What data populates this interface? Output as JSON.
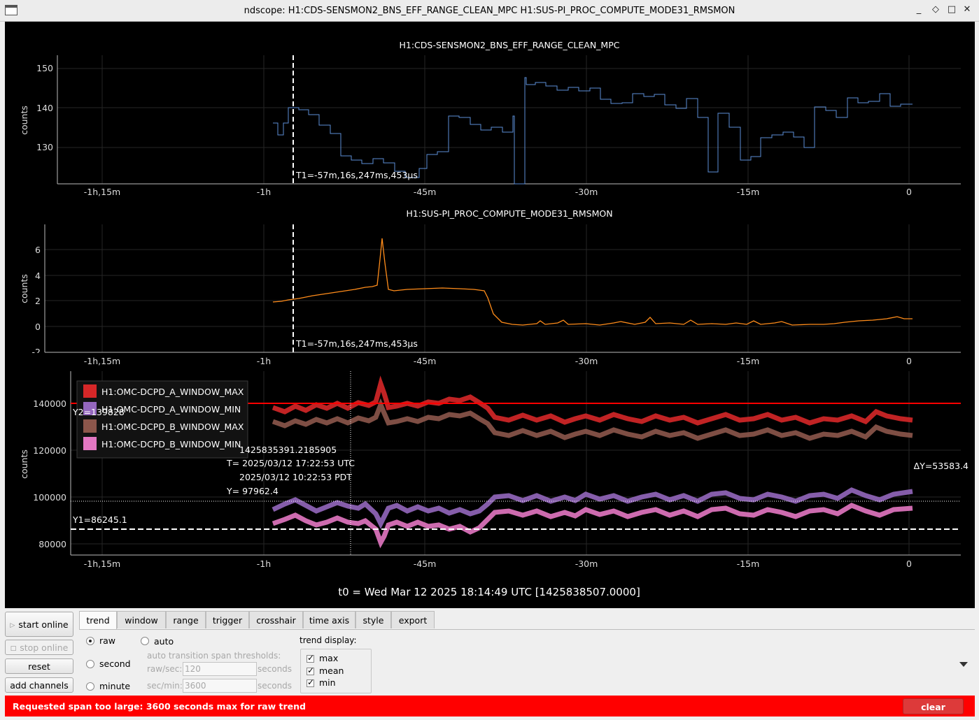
{
  "window": {
    "title": "ndscope: H1:CDS-SENSMON2_BNS_EFF_RANGE_CLEAN_MPC H1:SUS-PI_PROC_COMPUTE_MODE31_RMSMON",
    "minimize_glyph": "_",
    "restore_glyph": "◇",
    "maximize_glyph": "□",
    "close_glyph": "✕"
  },
  "x_ticks": [
    "-1h,15m",
    "-1h",
    "-45m",
    "-30m",
    "-15m",
    "0"
  ],
  "plots": [
    {
      "title": "H1:CDS-SENSMON2_BNS_EFF_RANGE_CLEAN_MPC",
      "ylabel": "counts",
      "y_ticks": [
        "150",
        "140",
        "130"
      ],
      "cursor_label": "T1=-57m,16s,247ms,453µs",
      "color": "#5b8ed6"
    },
    {
      "title": "H1:SUS-PI_PROC_COMPUTE_MODE31_RMSMON",
      "ylabel": "counts",
      "y_ticks": [
        "6",
        "4",
        "2",
        "0",
        "-2"
      ],
      "cursor_label": "T1=-57m,16s,247ms,453µs",
      "color": "#ff8c1a"
    },
    {
      "title": "",
      "ylabel": "counts",
      "y_ticks": [
        "140000",
        "120000",
        "100000",
        "80000"
      ],
      "legend": [
        {
          "name": "H1:OMC-DCPD_A_WINDOW_MAX",
          "color": "#d62728"
        },
        {
          "name": "H1:OMC-DCPD_A_WINDOW_MIN",
          "color": "#9467bd"
        },
        {
          "name": "H1:OMC-DCPD_B_WINDOW_MAX",
          "color": "#8c564b"
        },
        {
          "name": "H1:OMC-DCPD_B_WINDOW_MIN",
          "color": "#e377c2"
        }
      ],
      "y2_label": "Y2=139828",
      "y1_label": "Y1=86245.1",
      "dy_label": "ΔY=53583.4",
      "crosshair": {
        "gps": "1425835391.2185905",
        "utc": "T= 2025/03/12 17:22:53 UTC",
        "pdt": "2025/03/12 10:22:53 PDT",
        "y": "Y= 97962.4"
      }
    }
  ],
  "t0_label": "t0 = Wed Mar 12 2025 18:14:49 UTC [1425838507.0000]",
  "left_buttons": {
    "start_online": "start online",
    "stop_online": "stop online",
    "reset": "reset",
    "add_channels": "add channels"
  },
  "tabs": [
    "trend",
    "window",
    "range",
    "trigger",
    "crosshair",
    "time axis",
    "style",
    "export"
  ],
  "trend_panel": {
    "raw": "raw",
    "second": "second",
    "minute": "minute",
    "auto": "auto",
    "auto_header": "auto transition span thresholds:",
    "raw_sec_label": "raw/sec:",
    "raw_sec_value": "120",
    "sec_min_label": "sec/min:",
    "sec_min_value": "3600",
    "seconds_unit": "seconds",
    "trend_display_label": "trend display:",
    "display_max": "max",
    "display_mean": "mean",
    "display_min": "min"
  },
  "status": {
    "message": "Requested span too large: 3600 seconds max for raw trend",
    "clear_label": "clear"
  }
}
